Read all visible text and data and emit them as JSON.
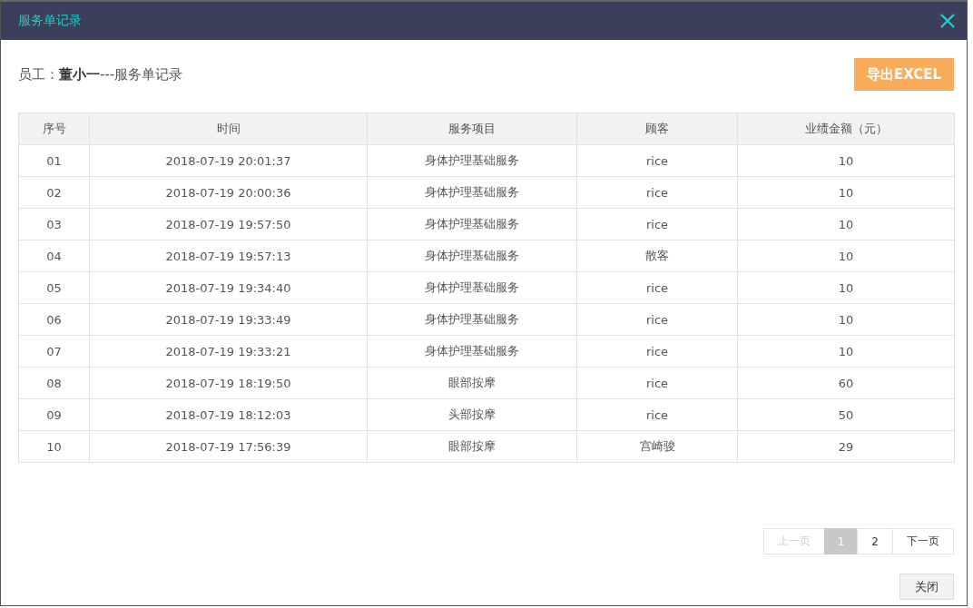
{
  "window": {
    "title": "服务单记录"
  },
  "subtitle": "员工：**董小一**---服务单记录",
  "export_button": "导出EXCEL",
  "table": {
    "columns": [
      "序号",
      "时间",
      "服务项目",
      "顾客",
      "业绩金额（元）"
    ],
    "rows": [
      [
        "01",
        "2018-07-19 20:01:37",
        "身体护理基础服务",
        "rice",
        "10"
      ],
      [
        "02",
        "2018-07-19 20:00:36",
        "身体护理基础服务",
        "rice",
        "10"
      ],
      [
        "03",
        "2018-07-19 19:57:50",
        "身体护理基础服务",
        "rice",
        "10"
      ],
      [
        "04",
        "2018-07-19 19:57:13",
        "身体护理基础服务",
        "散客",
        "10"
      ],
      [
        "05",
        "2018-07-19 19:34:40",
        "身体护理基础服务",
        "rice",
        "10"
      ],
      [
        "06",
        "2018-07-19 19:33:49",
        "身体护理基础服务",
        "rice",
        "10"
      ],
      [
        "07",
        "2018-07-19 19:33:21",
        "身体护理基础服务",
        "rice",
        "10"
      ],
      [
        "08",
        "2018-07-19 18:19:50",
        "眼部按摩",
        "rice",
        "60"
      ],
      [
        "09",
        "2018-07-19 18:12:03",
        "头部按摩",
        "rice",
        "50"
      ],
      [
        "10",
        "2018-07-19 17:56:39",
        "眼部按摩",
        "宫崎骏",
        "29"
      ]
    ]
  },
  "pagination": [
    {
      "label": "上一页",
      "selected": false,
      "disabled": true
    },
    {
      "label": "1",
      "selected": true,
      "disabled": false
    },
    {
      "label": "2",
      "selected": false,
      "disabled": false
    },
    {
      "label": "下一页",
      "selected": false,
      "disabled": false
    }
  ],
  "close_button": "关闭"
}
